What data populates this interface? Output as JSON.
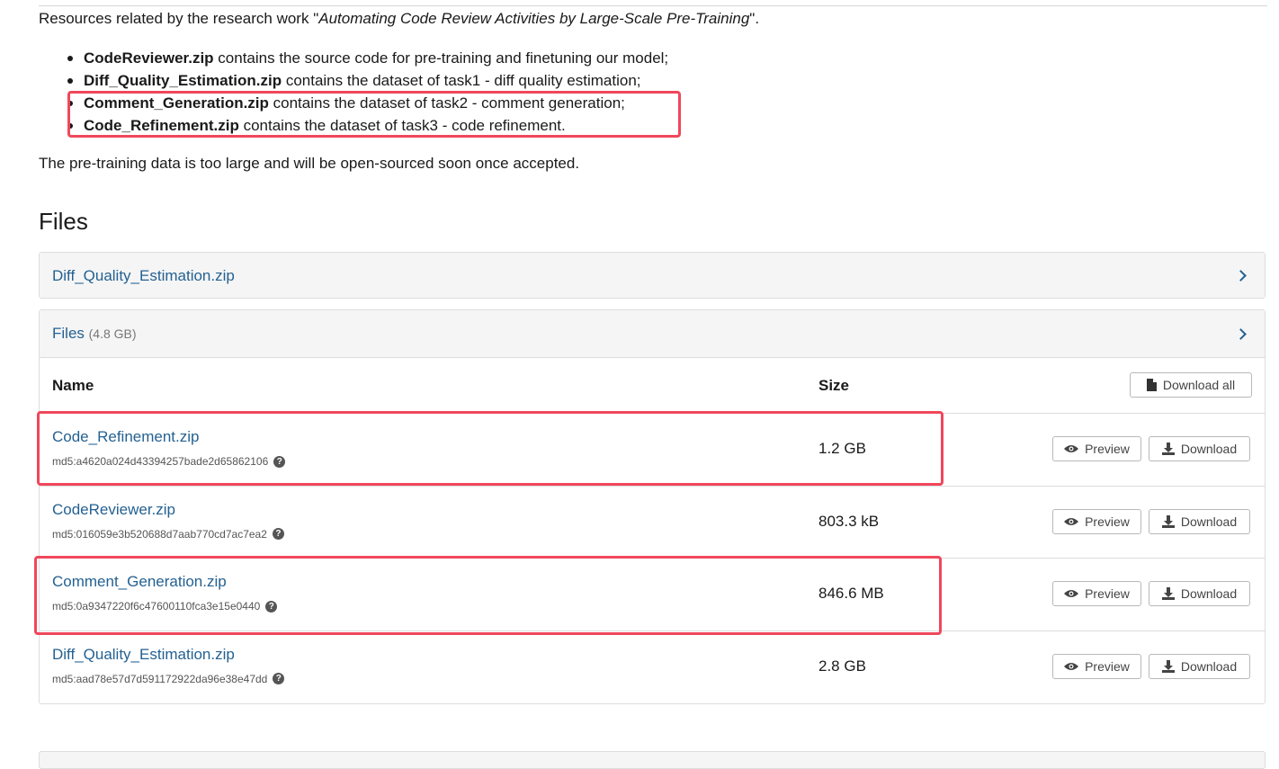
{
  "intro": {
    "prefix": "Resources related by the research work \"",
    "title": "Automating Code Review Activities by Large-Scale Pre-Training",
    "suffix": "\"."
  },
  "bullets": [
    {
      "file": "CodeReviewer.zip",
      "text": " contains the source code for pre-training and finetuning our model;"
    },
    {
      "file": "Diff_Quality_Estimation.zip",
      "text": " contains the dataset of task1 - diff quality estimation;"
    },
    {
      "file": "Comment_Generation.zip",
      "text": " contains the dataset of task2 - comment generation;"
    },
    {
      "file": "Code_Refinement.zip",
      "text": " contains the dataset of task3 - code refinement."
    }
  ],
  "note": "The pre-training data is too large and will be open-sourced soon once accepted.",
  "files_heading": "Files",
  "collapsed_panel": {
    "label": "Diff_Quality_Estimation.zip"
  },
  "files_panel": {
    "label": "Files",
    "size": "(4.8 GB)",
    "columns": {
      "name": "Name",
      "size": "Size"
    },
    "download_all": "Download all",
    "preview_label": "Preview",
    "download_label": "Download",
    "rows": [
      {
        "name": "Code_Refinement.zip",
        "md5": "md5:a4620a024d43394257bade2d65862106",
        "size": "1.2 GB"
      },
      {
        "name": "CodeReviewer.zip",
        "md5": "md5:016059e3b520688d7aab770cd7ac7ea2",
        "size": "803.3 kB"
      },
      {
        "name": "Comment_Generation.zip",
        "md5": "md5:0a9347220f6c47600110fca3e15e0440",
        "size": "846.6 MB"
      },
      {
        "name": "Diff_Quality_Estimation.zip",
        "md5": "md5:aad78e57d7d591172922da96e38e47dd",
        "size": "2.8 GB"
      }
    ]
  },
  "icons": {
    "chevron": "chevron-right-icon",
    "help": "question-circle-icon",
    "eye": "eye-icon",
    "download": "download-icon",
    "file": "file-icon"
  },
  "colors": {
    "link": "#246192",
    "highlight": "#f0475c",
    "panel_header": "#f5f5f5"
  }
}
